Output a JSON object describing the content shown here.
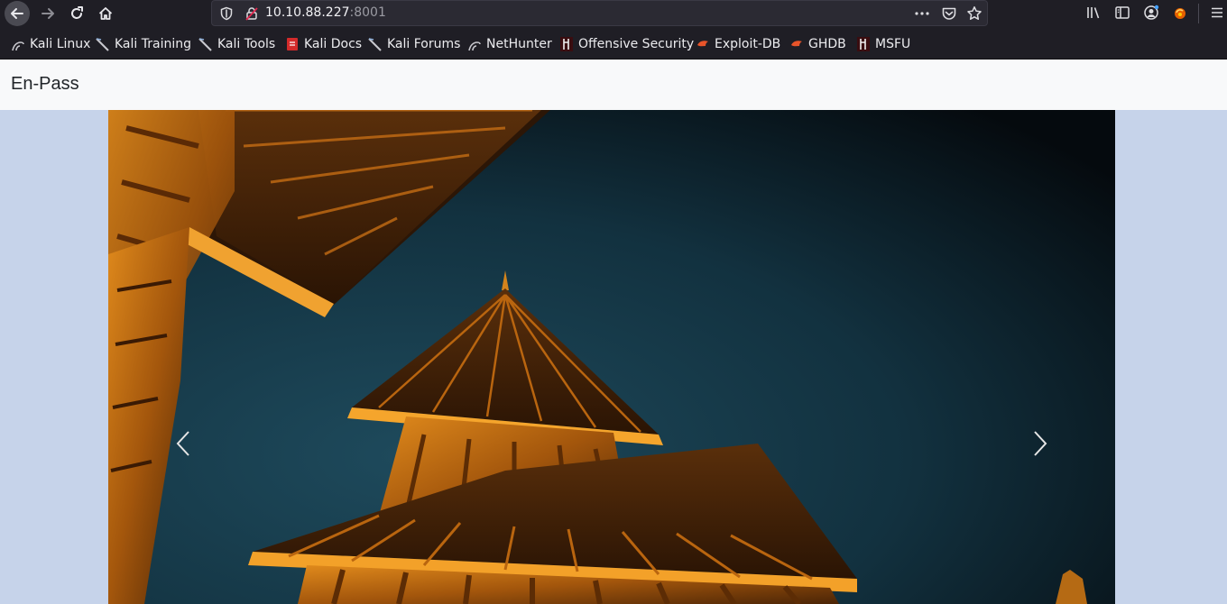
{
  "browser": {
    "url_host": "10.10.88.227",
    "url_port": ":8001",
    "bookmarks": [
      {
        "label": "Kali Linux",
        "icon": "kali-dragon-icon"
      },
      {
        "label": "Kali Training",
        "icon": "kali-sword-icon"
      },
      {
        "label": "Kali Tools",
        "icon": "kali-sword-icon"
      },
      {
        "label": "Kali Docs",
        "icon": "kali-docs-icon"
      },
      {
        "label": "Kali Forums",
        "icon": "kali-sword-icon"
      },
      {
        "label": "NetHunter",
        "icon": "kali-dragon-icon"
      },
      {
        "label": "Offensive Security",
        "icon": "offsec-icon"
      },
      {
        "label": "Exploit-DB",
        "icon": "exploit-db-icon"
      },
      {
        "label": "GHDB",
        "icon": "exploit-db-icon"
      },
      {
        "label": "MSFU",
        "icon": "offsec-icon"
      }
    ]
  },
  "page": {
    "brand": "En-Pass"
  },
  "colors": {
    "chrome_bg": "#1f1e25",
    "page_bg": "#c6d3ea",
    "navbar_bg": "#f8f9fa"
  }
}
